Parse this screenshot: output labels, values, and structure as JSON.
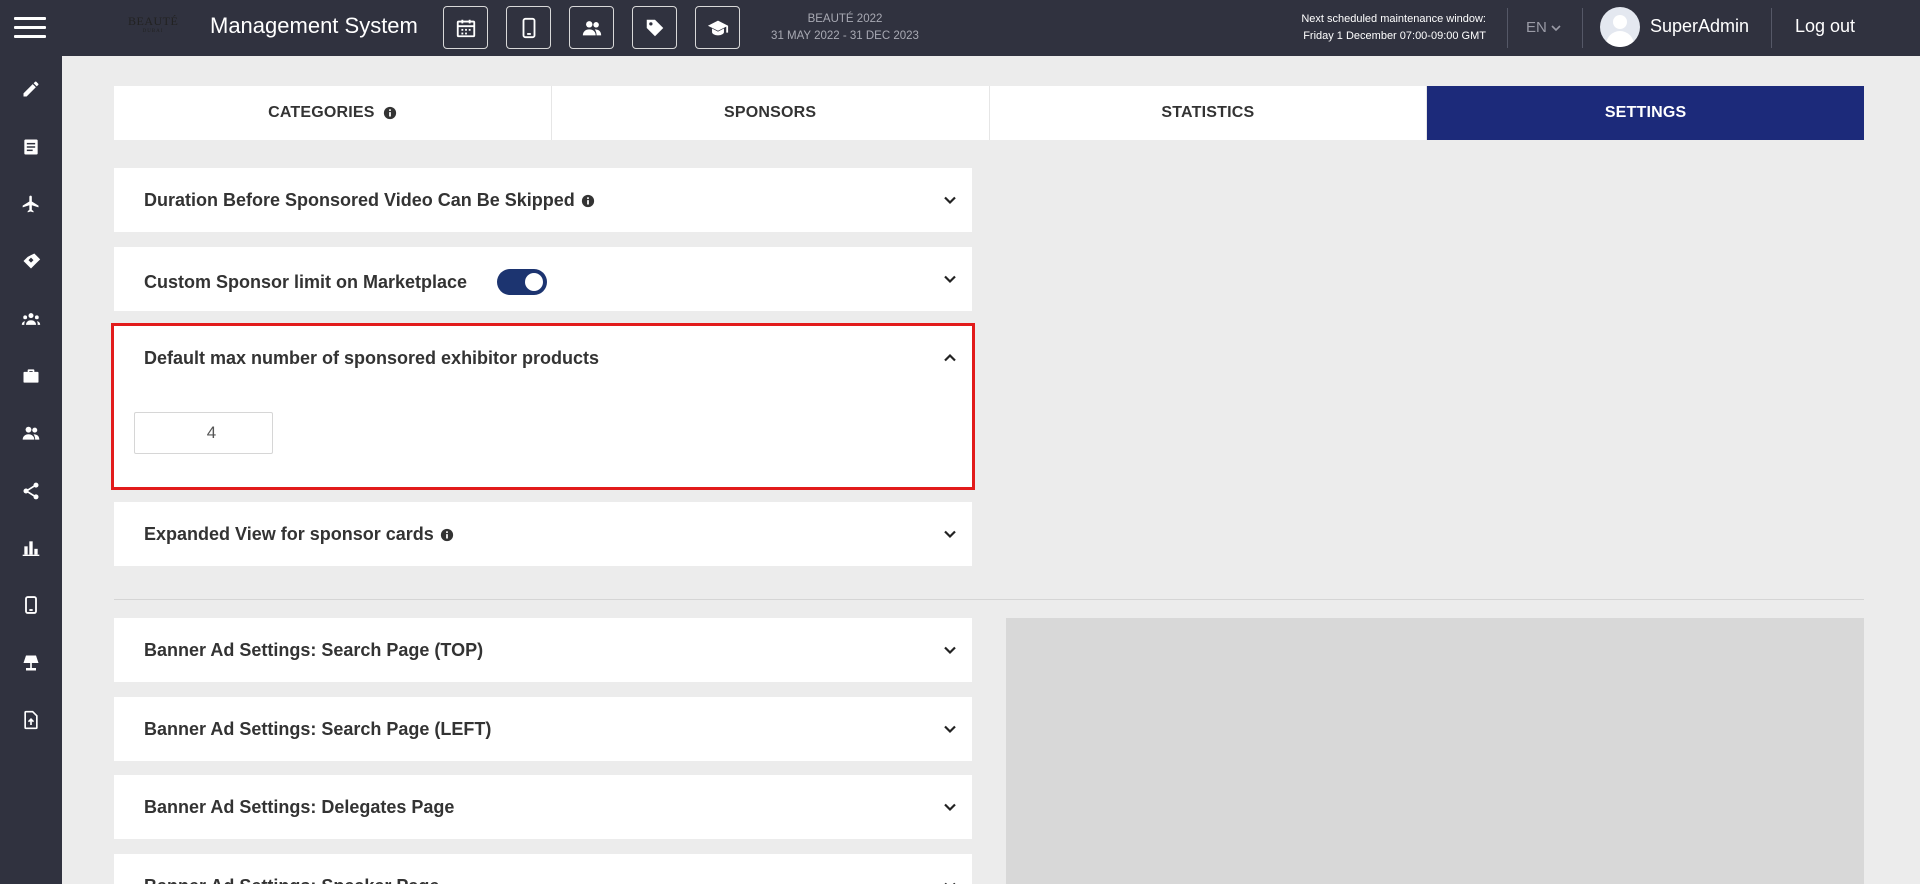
{
  "header": {
    "logo_text": "BEAUTÉ",
    "logo_sub": "DUBAI",
    "app_title": "Management System",
    "event_name": "BEAUTÉ 2022",
    "event_dates": "31 MAY 2022 - 31 DEC 2023",
    "maintenance_line1": "Next scheduled maintenance window:",
    "maintenance_line2": "Friday 1 December 07:00-09:00 GMT",
    "language": "EN",
    "username": "SuperAdmin",
    "logout_label": "Log out",
    "icons": [
      "calendar-icon",
      "mobile-icon",
      "users-icon",
      "tag-icon",
      "graduation-cap-icon"
    ]
  },
  "sidebar": {
    "items": [
      "pencil-icon",
      "list-icon",
      "plane-icon",
      "handshake-icon",
      "group-icon",
      "briefcase-icon",
      "users-icon",
      "share-icon",
      "bar-chart-icon",
      "mobile-icon",
      "lamp-icon",
      "file-upload-icon"
    ]
  },
  "tabs": [
    {
      "label": "CATEGORIES",
      "has_info": true,
      "active": false
    },
    {
      "label": "SPONSORS",
      "has_info": false,
      "active": false
    },
    {
      "label": "STATISTICS",
      "has_info": false,
      "active": false
    },
    {
      "label": "SETTINGS",
      "has_info": false,
      "active": true
    }
  ],
  "settings": {
    "duration_skip": {
      "title": "Duration Before Sponsored Video Can Be Skipped"
    },
    "custom_limit": {
      "title": "Custom Sponsor limit on Marketplace",
      "toggle_on": true
    },
    "default_max": {
      "title": "Default max number of sponsored exhibitor products",
      "value": "4"
    },
    "expanded_view": {
      "title": "Expanded View for sponsor cards"
    },
    "banner_top": {
      "title": "Banner Ad Settings: Search Page (TOP)"
    },
    "banner_left": {
      "title": "Banner Ad Settings: Search Page (LEFT)"
    },
    "banner_delegates": {
      "title": "Banner Ad Settings: Delegates Page"
    },
    "banner_speaker": {
      "title": "Banner Ad Settings: Speaker Page"
    }
  },
  "colors": {
    "topbar": "#30323f",
    "active_tab": "#1c2a7a",
    "highlight": "#e21b1b",
    "toggle": "#1c3470"
  }
}
